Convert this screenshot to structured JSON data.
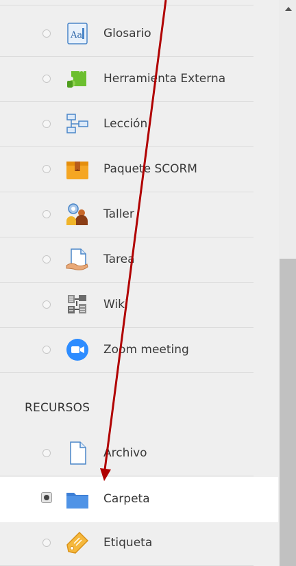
{
  "activities": [
    {
      "label": "Glosario",
      "icon": "glossary-icon"
    },
    {
      "label": "Herramienta Externa",
      "icon": "puzzle-icon"
    },
    {
      "label": "Lección",
      "icon": "lesson-icon"
    },
    {
      "label": "Paquete SCORM",
      "icon": "scorm-package-icon"
    },
    {
      "label": "Taller",
      "icon": "workshop-icon"
    },
    {
      "label": "Tarea",
      "icon": "assignment-icon"
    },
    {
      "label": "Wiki",
      "icon": "wiki-icon"
    },
    {
      "label": "Zoom meeting",
      "icon": "zoom-icon"
    }
  ],
  "resources_heading": "RECURSOS",
  "resources": [
    {
      "label": "Archivo",
      "icon": "file-icon",
      "selected": false
    },
    {
      "label": "Carpeta",
      "icon": "folder-icon",
      "selected": true
    },
    {
      "label": "Etiqueta",
      "icon": "label-tag-icon",
      "selected": false
    }
  ],
  "colors": {
    "annotation_arrow": "#b00000",
    "folder": "#3d7fd6",
    "zoom": "#2d8cff"
  }
}
